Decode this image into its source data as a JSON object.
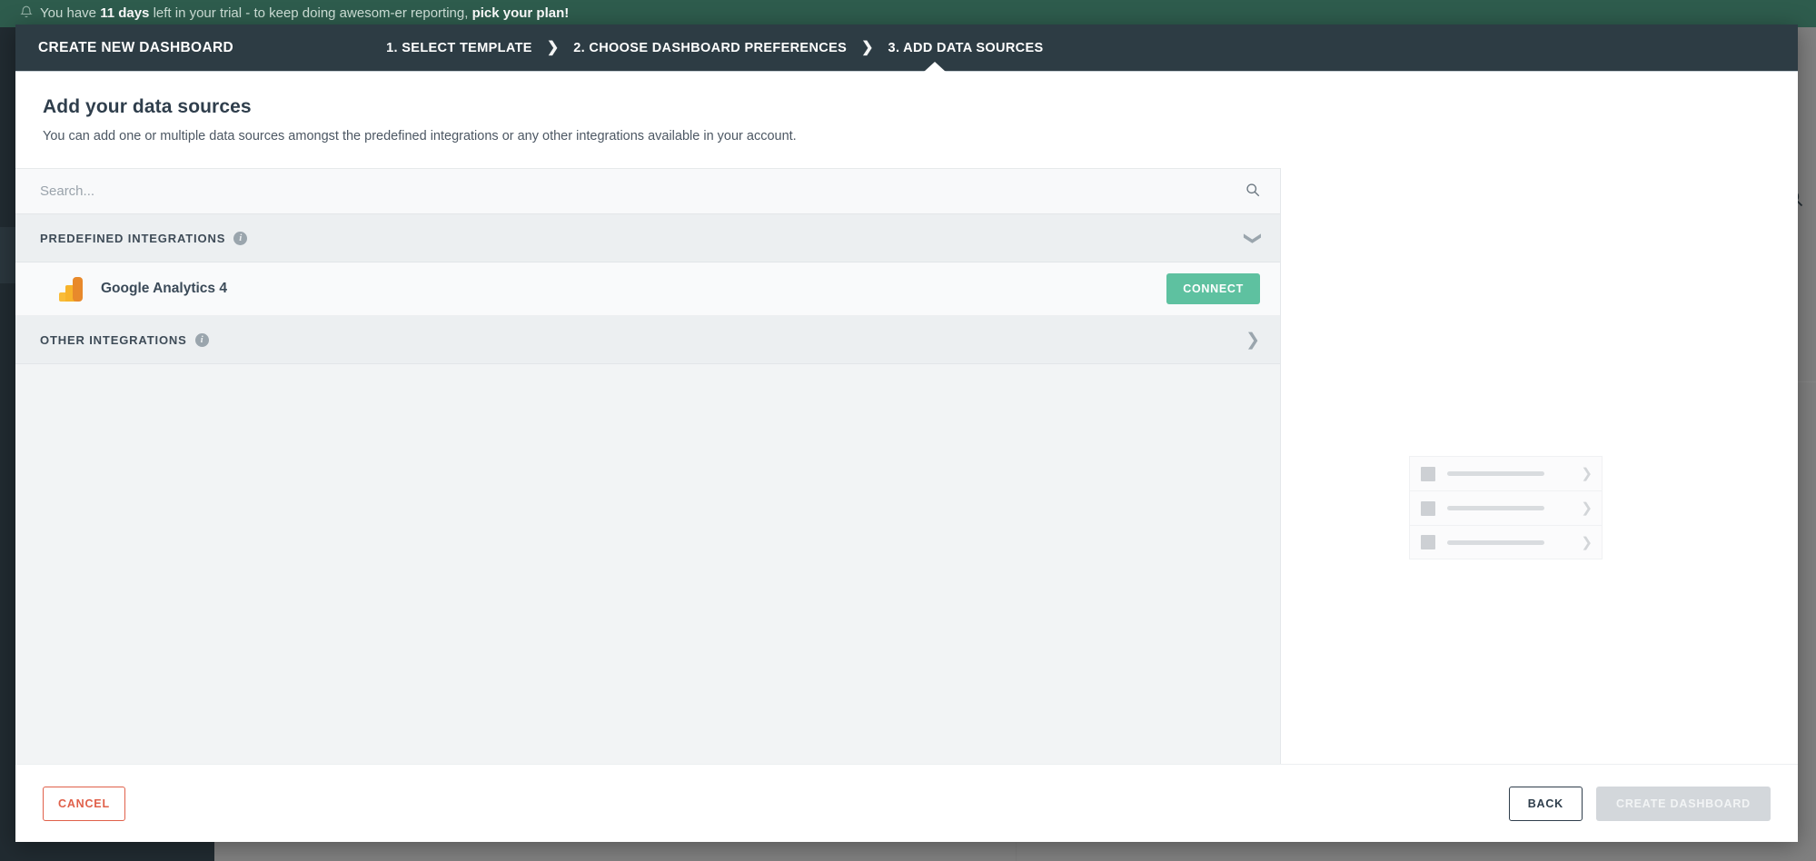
{
  "background": {
    "trial_banner": {
      "prefix": "You have ",
      "days": "11 days",
      "middle": " left in your trial - to keep doing awesom-er reporting, ",
      "cta": "pick your plan!",
      "bell_icon": "bell-icon",
      "bg_color": "#2e5c4d"
    },
    "search_icon": "search-icon"
  },
  "modal": {
    "header": {
      "title": "CREATE NEW DASHBOARD",
      "separator": "❯",
      "steps": [
        {
          "label": "1. SELECT TEMPLATE"
        },
        {
          "label": "2. CHOOSE DASHBOARD PREFERENCES"
        },
        {
          "label": "3. ADD DATA SOURCES"
        }
      ],
      "bg_color": "#2d3c44"
    },
    "intro": {
      "heading": "Add your data sources",
      "description": "You can add one or multiple data sources amongst the predefined integrations or any other integrations available in your account."
    },
    "search": {
      "placeholder": "Search...",
      "value": "",
      "icon": "search-icon"
    },
    "sections": [
      {
        "id": "predefined",
        "label": "PREDEFINED INTEGRATIONS",
        "info_icon": "info-icon",
        "toggle_icon": "chevron-down-icon",
        "expanded": true
      },
      {
        "id": "other",
        "label": "OTHER INTEGRATIONS",
        "info_icon": "info-icon",
        "toggle_icon": "chevron-right-icon",
        "expanded": false
      }
    ],
    "integrations": [
      {
        "name": "Google Analytics 4",
        "icon": "google-analytics-icon",
        "action_label": "CONNECT",
        "action_color": "#5ec1a0"
      }
    ],
    "preview": {
      "skeleton_rows": [
        {
          "chevron_icon": "chevron-right-icon"
        },
        {
          "chevron_icon": "chevron-right-icon"
        },
        {
          "chevron_icon": "chevron-right-icon"
        }
      ]
    },
    "footer": {
      "cancel_label": "CANCEL",
      "back_label": "BACK",
      "create_label": "CREATE DASHBOARD",
      "cancel_color": "#e0604a",
      "create_disabled": true
    }
  }
}
